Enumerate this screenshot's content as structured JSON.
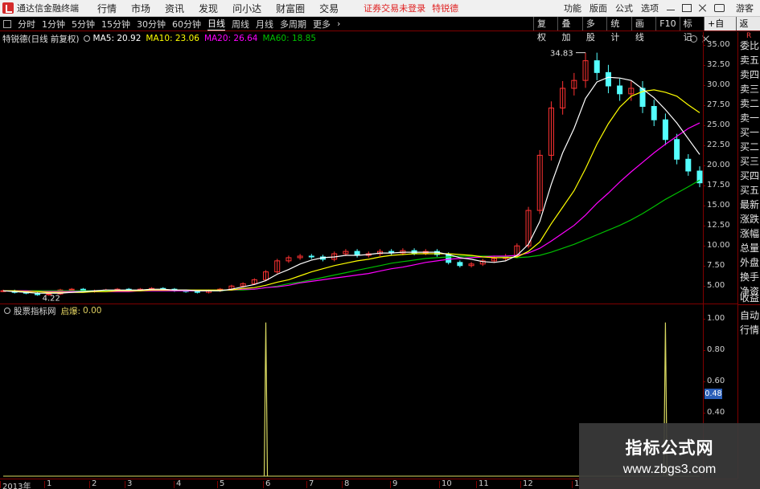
{
  "app": {
    "title": "通达信金融终端"
  },
  "menu": [
    "行情",
    "市场",
    "资讯",
    "发现",
    "问小达",
    "财富圈",
    "交易"
  ],
  "login_status": "证券交易未登录",
  "stock_name": "特锐德",
  "right_menu": [
    "功能",
    "版面",
    "公式",
    "选项"
  ],
  "guest_label": "游客",
  "periods": [
    "分时",
    "1分钟",
    "5分钟",
    "15分钟",
    "30分钟",
    "60分钟",
    "日线",
    "周线",
    "月线",
    "多周期",
    "更多"
  ],
  "toolbar_buttons": [
    "复权",
    "叠加",
    "多股",
    "统计",
    "画线",
    "F10",
    "标记",
    "+自选",
    "返回"
  ],
  "header": {
    "title": "特锐德(日线 前复权)",
    "ma5": "MA5: 20.92",
    "ma10": "MA10: 23.06",
    "ma20": "MA20: 26.64",
    "ma60": "MA60: 18.85"
  },
  "indicator": {
    "name": "股票指标网",
    "label": "启爆:",
    "value": "0.00"
  },
  "annotations": {
    "high": "34.83",
    "low": "4.22"
  },
  "price_axis": [
    "35.00",
    "32.50",
    "30.00",
    "27.50",
    "25.00",
    "22.50",
    "20.00",
    "17.50",
    "15.00",
    "12.50",
    "10.00",
    "7.50",
    "5.00"
  ],
  "indicator_axis": [
    "1.00",
    "0.80",
    "0.60",
    "0.48",
    "0.40"
  ],
  "side_panel": [
    "R",
    "委比",
    "卖五",
    "卖四",
    "卖三",
    "卖二",
    "卖一",
    "买一",
    "买二",
    "买三",
    "买四",
    "买五",
    "最新",
    "涨跌",
    "涨幅",
    "总量",
    "外盘",
    "换手",
    "净资",
    "收益",
    "自动",
    "行情"
  ],
  "date_axis": [
    "2013年",
    "1",
    "2",
    "3",
    "4",
    "5",
    "6",
    "7",
    "8",
    "9",
    "10",
    "11",
    "12",
    "1"
  ],
  "watermark": {
    "title": "指标公式网",
    "url": "www.zbgs3.com"
  },
  "colors": {
    "up": "#ff3232",
    "down": "#54ffff",
    "ma5": "#ffffff",
    "ma10": "#ffff00",
    "ma20": "#ff00ff",
    "ma60": "#00c000",
    "signal": "#d8d860",
    "grid": "#800000"
  },
  "chart_data": {
    "type": "candlestick",
    "price_range": [
      4,
      36
    ],
    "indicator_range": [
      0,
      1.05
    ],
    "close": [
      4.8,
      4.6,
      4.5,
      4.3,
      4.4,
      4.9,
      5.0,
      4.7,
      4.8,
      4.9,
      5.0,
      4.9,
      5.0,
      5.1,
      5.0,
      4.8,
      4.7,
      4.6,
      4.8,
      5.0,
      5.4,
      5.7,
      6.2,
      7.2,
      8.6,
      9.0,
      9.2,
      9.1,
      8.8,
      9.5,
      9.8,
      9.3,
      9.5,
      9.8,
      9.6,
      9.9,
      9.6,
      9.8,
      9.4,
      8.4,
      8.0,
      8.2,
      8.6,
      8.9,
      9.2,
      10.5,
      15.0,
      22.0,
      28.0,
      30.5,
      31.5,
      34.0,
      32.5,
      30.8,
      29.8,
      30.5,
      28.2,
      26.5,
      24.0,
      21.5,
      20.0,
      18.5
    ],
    "ma5": [
      4.8,
      4.7,
      4.6,
      4.5,
      4.5,
      4.5,
      4.6,
      4.7,
      4.8,
      4.9,
      4.9,
      4.9,
      4.9,
      5.0,
      5.0,
      4.9,
      4.9,
      4.8,
      4.8,
      4.8,
      5.0,
      5.3,
      5.6,
      6.1,
      6.9,
      7.5,
      8.2,
      8.7,
      9.0,
      9.1,
      9.3,
      9.3,
      9.4,
      9.6,
      9.6,
      9.7,
      9.7,
      9.7,
      9.7,
      9.4,
      9.0,
      8.8,
      8.5,
      8.4,
      8.6,
      9.3,
      10.7,
      13.6,
      18.3,
      22.3,
      25.4,
      29.2,
      31.3,
      31.9,
      31.8,
      31.5,
      30.4,
      29.3,
      27.8,
      26.1,
      24.1,
      22.1
    ],
    "ma10": [
      4.8,
      4.8,
      4.7,
      4.7,
      4.6,
      4.6,
      4.6,
      4.6,
      4.7,
      4.7,
      4.8,
      4.8,
      4.8,
      4.9,
      4.9,
      4.9,
      4.9,
      4.9,
      4.9,
      4.9,
      4.9,
      5.1,
      5.2,
      5.5,
      5.9,
      6.2,
      6.7,
      7.2,
      7.6,
      8.0,
      8.3,
      8.6,
      8.8,
      9.1,
      9.3,
      9.4,
      9.5,
      9.5,
      9.5,
      9.5,
      9.4,
      9.3,
      9.1,
      9.0,
      9.0,
      9.1,
      9.8,
      11.0,
      13.3,
      15.4,
      17.5,
      20.3,
      23.4,
      26.0,
      28.1,
      29.5,
      30.1,
      30.3,
      30.0,
      29.5,
      28.4,
      27.4
    ],
    "ma20": [
      4.8,
      4.8,
      4.8,
      4.7,
      4.7,
      4.7,
      4.7,
      4.7,
      4.7,
      4.7,
      4.7,
      4.7,
      4.8,
      4.8,
      4.8,
      4.8,
      4.8,
      4.8,
      4.8,
      4.9,
      4.9,
      5.0,
      5.0,
      5.2,
      5.3,
      5.5,
      5.8,
      6.0,
      6.2,
      6.4,
      6.6,
      6.8,
      7.0,
      7.3,
      7.6,
      7.8,
      8.1,
      8.4,
      8.6,
      8.8,
      8.9,
      9.0,
      9.1,
      9.2,
      9.2,
      9.3,
      9.6,
      10.2,
      11.1,
      12.1,
      13.1,
      14.4,
      15.9,
      17.2,
      18.6,
      19.9,
      21.1,
      22.3,
      23.4,
      24.4,
      25.4,
      26.1
    ],
    "ma60": [
      4.8,
      4.8,
      4.8,
      4.8,
      4.8,
      4.8,
      4.8,
      4.8,
      4.8,
      4.8,
      4.8,
      4.8,
      4.8,
      4.8,
      4.8,
      4.8,
      4.8,
      4.8,
      4.8,
      4.8,
      4.9,
      4.9,
      5.0,
      5.2,
      5.4,
      5.7,
      5.9,
      6.2,
      6.5,
      6.8,
      7.1,
      7.4,
      7.7,
      8.0,
      8.3,
      8.5,
      8.7,
      8.9,
      9.0,
      9.1,
      9.2,
      9.2,
      9.2,
      9.2,
      9.1,
      9.0,
      9.1,
      9.3,
      9.7,
      10.2,
      10.7,
      11.3,
      11.9,
      12.5,
      13.1,
      13.8,
      14.6,
      15.5,
      16.4,
      17.2,
      18.0,
      18.85
    ],
    "signal_bars": [
      {
        "index": 23,
        "value": 1.0
      },
      {
        "index": 58,
        "value": 1.0
      }
    ],
    "signal_value": 0.0
  }
}
